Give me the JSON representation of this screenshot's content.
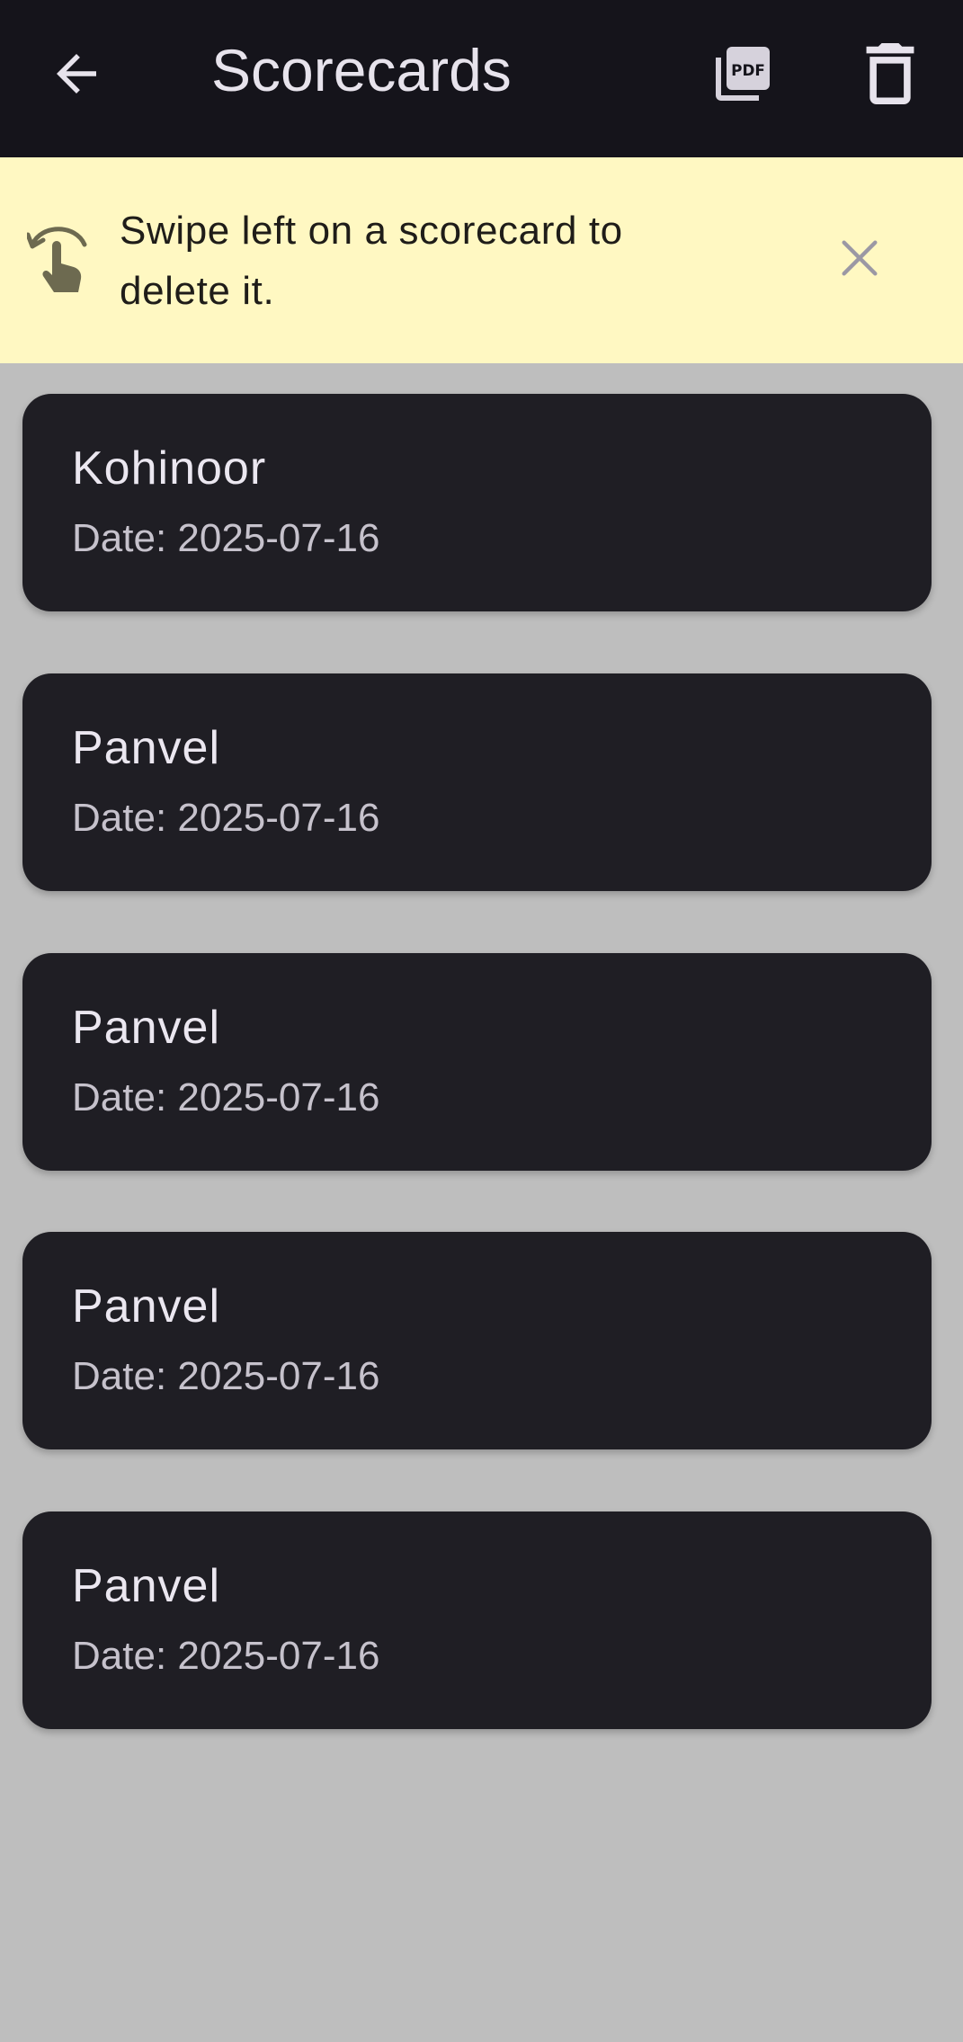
{
  "app_bar": {
    "title": "Scorecards",
    "back_icon": "arrow-left-icon",
    "pdf_icon": "pdf-export-icon",
    "delete_icon": "trash-icon"
  },
  "banner": {
    "message": "Swipe left on a scorecard to delete it.",
    "gesture_icon": "swipe-left-gesture-icon",
    "close_icon": "close-icon"
  },
  "scorecards": [
    {
      "name": "Kohinoor",
      "date": "Date: 2025-07-16"
    },
    {
      "name": "Panvel",
      "date": "Date: 2025-07-16"
    },
    {
      "name": "Panvel",
      "date": "Date: 2025-07-16"
    },
    {
      "name": "Panvel",
      "date": "Date: 2025-07-16"
    },
    {
      "name": "Panvel",
      "date": "Date: 2025-07-16"
    }
  ],
  "colors": {
    "app_bar_bg": "#15141b",
    "banner_bg": "#fff8c2",
    "card_bg": "#1f1e24",
    "page_bg": "#bebebe"
  }
}
